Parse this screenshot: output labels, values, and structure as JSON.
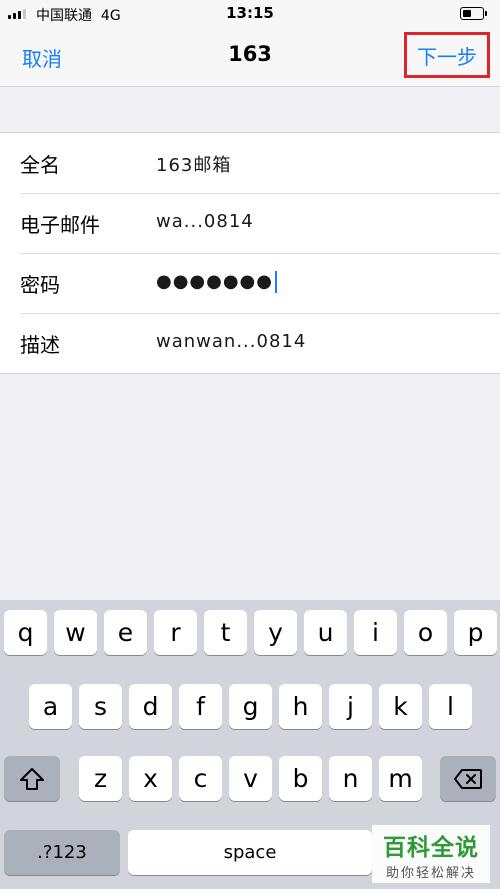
{
  "status_bar": {
    "carrier": "中国联通",
    "network": "4G",
    "time": "13:15",
    "battery_level": 0.45
  },
  "nav": {
    "cancel_label": "取消",
    "title": "163",
    "next_label": "下一步",
    "accent_color": "#157efb",
    "highlight_color": "#e0242b"
  },
  "form": {
    "fields": [
      {
        "label": "全名",
        "value": "163邮箱"
      },
      {
        "label": "电子邮件",
        "value": "wa...0814"
      },
      {
        "label": "密码",
        "value": "●●●●●●●"
      },
      {
        "label": "描述",
        "value": "wanwan...0814"
      }
    ]
  },
  "keyboard": {
    "row1": [
      "q",
      "w",
      "e",
      "r",
      "t",
      "y",
      "u",
      "i",
      "o",
      "p"
    ],
    "row2": [
      "a",
      "s",
      "d",
      "f",
      "g",
      "h",
      "j",
      "k",
      "l"
    ],
    "row3": [
      "z",
      "x",
      "c",
      "v",
      "b",
      "n",
      "m"
    ],
    "shift_icon": "shift-icon",
    "backspace_icon": "backspace-icon",
    "numbers_label": ".?123",
    "space_label": "space"
  },
  "watermark": {
    "title": "百科全说",
    "subtitle": "助你轻松解决"
  }
}
